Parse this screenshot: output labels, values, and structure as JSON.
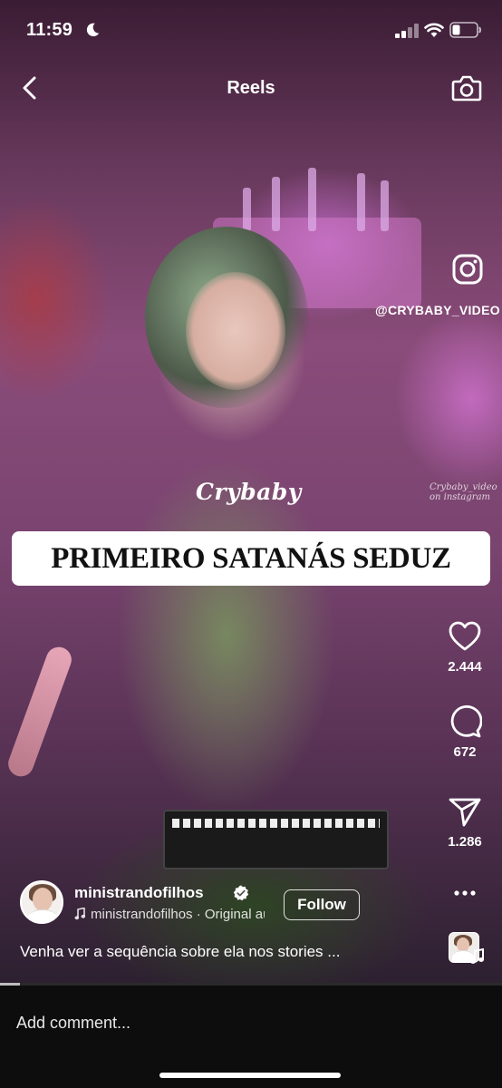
{
  "status_bar": {
    "time": "11:59",
    "icons": [
      "moon-icon",
      "signal-icon",
      "wifi-icon",
      "battery-icon"
    ]
  },
  "header": {
    "title": "Reels",
    "back_icon": "chevron-left-icon",
    "camera_icon": "camera-icon"
  },
  "overlay": {
    "watermark_icon": "instagram-icon",
    "watermark_handle": "@CRYBABY_VIDEO",
    "logo_text": "Crybaby",
    "small_watermark_line1": "Crybaby_video",
    "small_watermark_line2": "on instagram",
    "banner_text": "PRIMEIRO SATANÁS SEDUZ"
  },
  "actions": {
    "likes": "2.444",
    "comments": "672",
    "shares": "1.286"
  },
  "author": {
    "username": "ministrandofilhos",
    "verified": true,
    "audio_text": "ministrandofilhos · Original audio",
    "follow_label": "Follow",
    "caption": "Venha ver a sequência sobre ela nos stories ..."
  },
  "playback": {
    "progress": 0.04
  },
  "comment": {
    "placeholder": "Add comment..."
  },
  "colors": {
    "banner_bg": "#ffffff",
    "banner_text": "#111111",
    "comment_bar_bg": "#0d0d0d"
  }
}
